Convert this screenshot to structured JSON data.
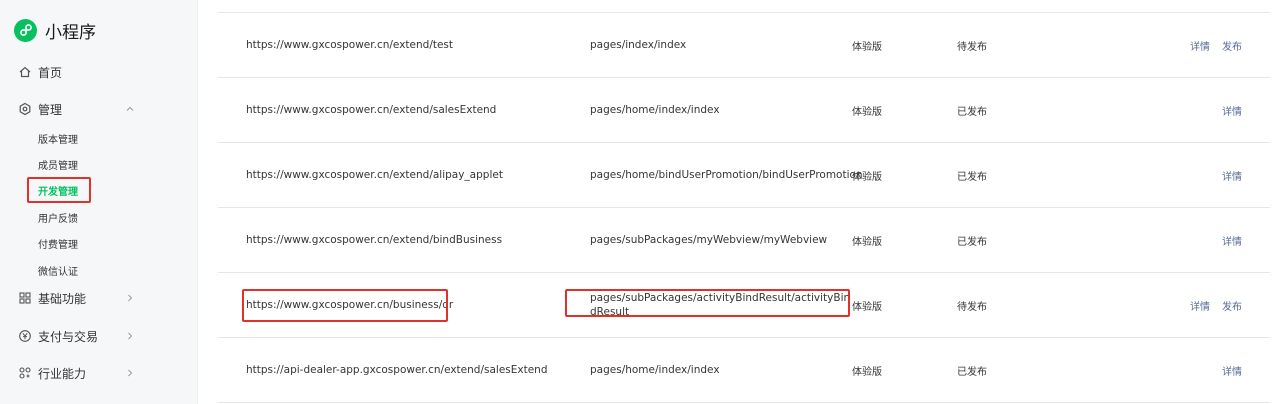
{
  "app": {
    "title": "小程序"
  },
  "sidebar": {
    "home": "首页",
    "manage": "管理",
    "manage_items": [
      "版本管理",
      "成员管理",
      "开发管理",
      "用户反馈",
      "付费管理",
      "微信认证"
    ],
    "basic": "基础功能",
    "payment": "支付与交易",
    "industry": "行业能力",
    "active_item": "开发管理"
  },
  "table": {
    "rows": [
      {
        "url": "https://www.gxcospower.cn/extend/test",
        "path": "pages/index/index",
        "version": "体验版",
        "status": "待发布",
        "ops": [
          "详情",
          "发布"
        ]
      },
      {
        "url": "https://www.gxcospower.cn/extend/salesExtend",
        "path": "pages/home/index/index",
        "version": "体验版",
        "status": "已发布",
        "ops": [
          "详情"
        ]
      },
      {
        "url": "https://www.gxcospower.cn/extend/alipay_applet",
        "path": "pages/home/bindUserPromotion/bindUserPromotion",
        "version": "体验版",
        "status": "已发布",
        "ops": [
          "详情"
        ]
      },
      {
        "url": "https://www.gxcospower.cn/extend/bindBusiness",
        "path": "pages/subPackages/myWebview/myWebview",
        "version": "体验版",
        "status": "已发布",
        "ops": [
          "详情"
        ]
      },
      {
        "url": "https://www.gxcospower.cn/business/qr",
        "path": "pages/subPackages/activityBindResult/activityBindResult",
        "version": "体验版",
        "status": "待发布",
        "ops": [
          "详情",
          "发布"
        ]
      },
      {
        "url": "https://api-dealer-app.gxcospower.cn/extend/salesExtend",
        "path": "pages/home/index/index",
        "version": "体验版",
        "status": "已发布",
        "ops": [
          "详情"
        ]
      }
    ]
  },
  "colors": {
    "brand": "#07c160",
    "link": "#576b95",
    "highlight": "#e0322a"
  },
  "icons": {
    "logo": "mini-program-logo-icon",
    "home": "home-icon",
    "manage": "settings-icon",
    "basic": "grid-icon",
    "payment": "yen-icon",
    "industry": "industry-icon"
  }
}
